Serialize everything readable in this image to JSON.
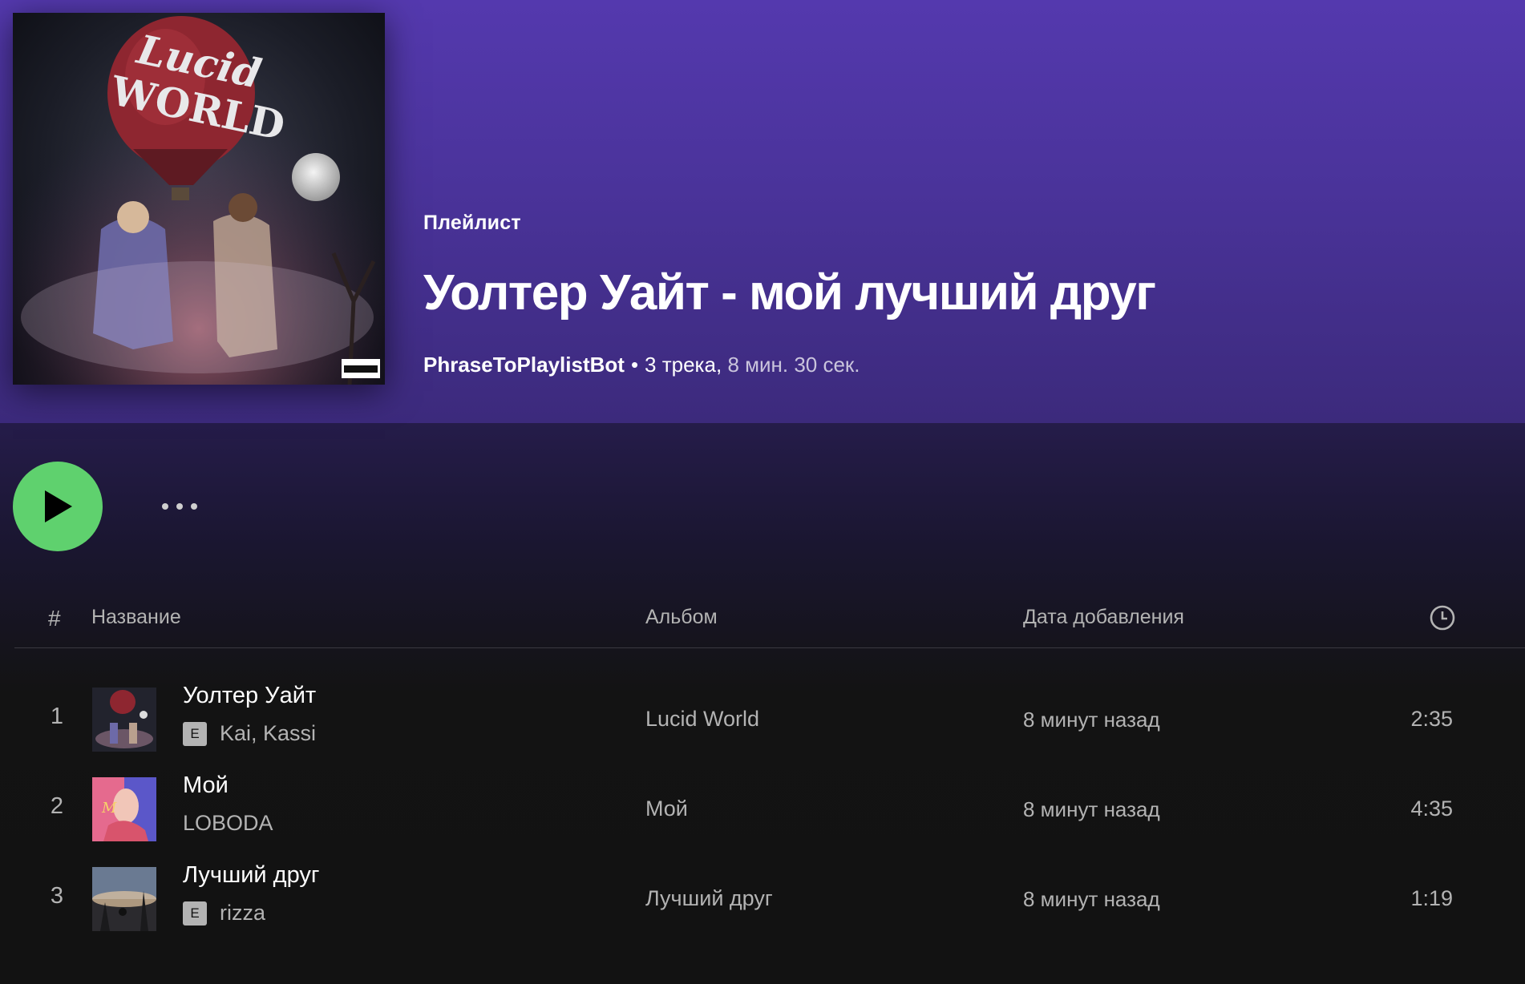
{
  "playlist": {
    "type_label": "Плейлист",
    "title": "Уолтер Уайт - мой лучший друг",
    "owner": "PhraseToPlaylistBot",
    "separator": "•",
    "track_count": "3 трека,",
    "duration": "8 мин. 30 сек.",
    "cover_art_text": "Lucid WORLD"
  },
  "controls": {
    "play_icon": "play-icon",
    "more_icon": "more-options-icon"
  },
  "table": {
    "headers": {
      "number": "#",
      "title": "Название",
      "album": "Альбом",
      "date_added": "Дата добавления",
      "duration_icon": "clock-icon"
    },
    "tracks": [
      {
        "number": "1",
        "title": "Уолтер Уайт",
        "explicit": true,
        "explicit_label": "E",
        "artists": "Kai, Kassi",
        "album": "Lucid World",
        "date_added": "8 минут назад",
        "duration": "2:35"
      },
      {
        "number": "2",
        "title": "Мой",
        "explicit": false,
        "explicit_label": "",
        "artists": "LOBODA",
        "album": "Мой",
        "date_added": "8 минут назад",
        "duration": "4:35"
      },
      {
        "number": "3",
        "title": "Лучший друг",
        "explicit": true,
        "explicit_label": "E",
        "artists": "rizza",
        "album": "Лучший друг",
        "date_added": "8 минут назад",
        "duration": "1:19"
      }
    ]
  },
  "colors": {
    "header_top": "#5439ae",
    "background": "#121212",
    "play_button": "#5fd16e",
    "text_secondary": "#b3b3b3"
  }
}
